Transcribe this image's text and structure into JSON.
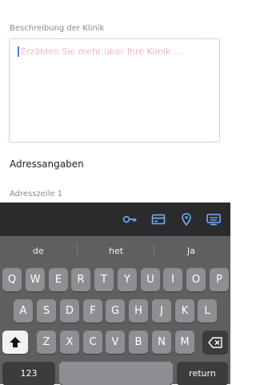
{
  "form": {
    "description_label": "Beschreibung der Klinik",
    "description_placeholder": "Erzählen Sie mehr über Ihre Klinik ...",
    "section_title": "Adressangaben",
    "address_label": "Adresszeile 1"
  },
  "accessory_bar": {
    "icons": [
      "key-icon",
      "credit-card-icon",
      "location-pin-icon",
      "keyboard-icon"
    ]
  },
  "keyboard": {
    "predictions": [
      "de",
      "het",
      "Ja"
    ],
    "row1": [
      "Q",
      "W",
      "E",
      "R",
      "T",
      "Y",
      "U",
      "I",
      "O",
      "P"
    ],
    "row2": [
      "A",
      "S",
      "D",
      "F",
      "G",
      "H",
      "J",
      "K",
      "L"
    ],
    "row3": [
      "Z",
      "X",
      "C",
      "V",
      "B",
      "N",
      "M"
    ],
    "numbers_key": "123",
    "return_key": "return"
  },
  "colors": {
    "accent": "#5b7ae6",
    "placeholder": "#f0b9c3",
    "keyboard_bg": "#5f5f62",
    "key": "#8f8f93"
  }
}
